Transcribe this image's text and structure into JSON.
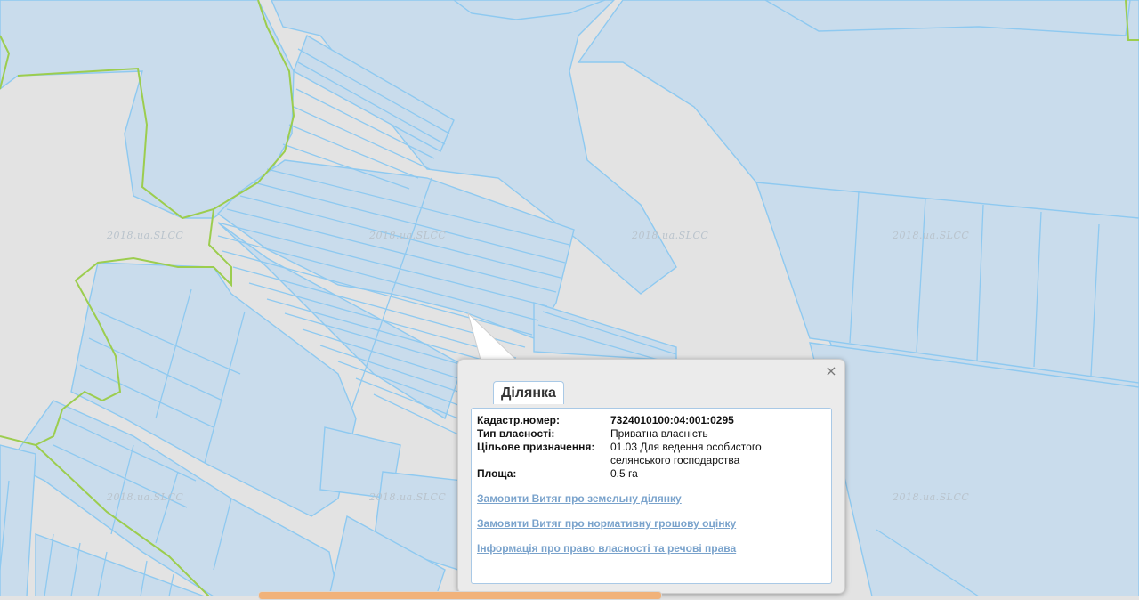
{
  "colors": {
    "background": "#e3e3e3",
    "parcel_fill": "#c9dcec",
    "parcel_stroke": "#8ec9f0",
    "boundary_line": "#9ccd4e",
    "link": "#7aa3cc"
  },
  "map": {
    "watermark_text": "2018.ua.SLCC",
    "watermark_count": 8
  },
  "popup": {
    "tab_label": "Ділянка",
    "close_icon": "×",
    "fields": [
      {
        "label": "Кадастр.номер:",
        "value": "7324010100:04:001:0295",
        "bold": true
      },
      {
        "label": "Тип власності:",
        "value": "Приватна власність",
        "bold": false
      },
      {
        "label": "Цільове призначення:",
        "value": "01.03 Для ведення особистого селянського господарства",
        "bold": false
      },
      {
        "label": "Площа:",
        "value": "0.5 га",
        "bold": false
      }
    ],
    "links": [
      "Замовити Витяг про земельну ділянку",
      "Замовити Витяг про нормативну грошову оцінку",
      "Інформація про право власності та речові права"
    ]
  }
}
